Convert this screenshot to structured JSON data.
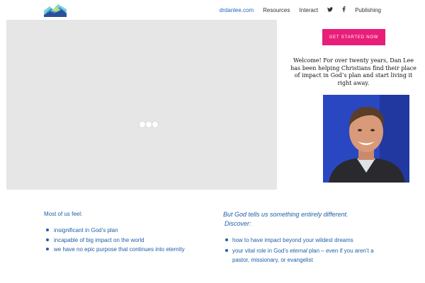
{
  "header": {
    "logo_icon": "mountain-logo-icon",
    "nav": [
      {
        "label": "drdanlee.com",
        "active": true
      },
      {
        "label": "Resources"
      },
      {
        "label": "Interact"
      },
      {
        "label": "Publishing"
      }
    ],
    "twitter_glyph": "𝕥",
    "facebook_glyph": "f",
    "accent_color": "#1f68c1"
  },
  "video": {
    "background": "#e6e6e6",
    "loader_icon": "loading-dots-icon"
  },
  "cta": {
    "label": "GET STARTED NOW",
    "color": "#e91e79"
  },
  "welcome": {
    "text": "Welcome!  For over twenty years, Dan Lee has been helping Christians find their place of impact in God’s plan and start living it right away."
  },
  "photo": {
    "icon": "portrait-photo"
  },
  "feel": {
    "title": "Most of us feel:",
    "items": [
      "insignificant in God’s plan",
      "incapable of big impact on the world",
      "we have no epic purpose that continues into eternity"
    ]
  },
  "discover": {
    "title_line1": "But God tells us something entirely different.",
    "title_line2": "Discover:",
    "item1": "how to have impact beyond your wildest dreams",
    "item2_before": "your vital role in God’s ",
    "item2_em": "eternal",
    "item2_after": " plan – even if you aren’t a pastor, missionary, or evangelist"
  },
  "text_color": "#1e5ea8"
}
